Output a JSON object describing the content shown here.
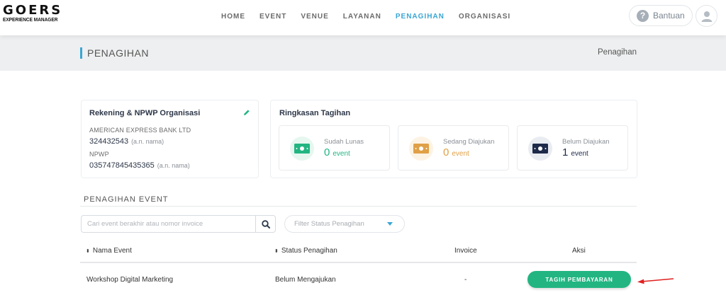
{
  "brand": {
    "name": "GOERS",
    "tagline": "EXPERIENCE MANAGER"
  },
  "nav": [
    "HOME",
    "EVENT",
    "VENUE",
    "LAYANAN",
    "PENAGIHAN",
    "ORGANISASI"
  ],
  "nav_active": "PENAGIHAN",
  "help": {
    "label": "Bantuan",
    "icon": "?"
  },
  "page": {
    "title": "PENAGIHAN",
    "breadcrumb": "Penagihan"
  },
  "rekening": {
    "title": "Rekening & NPWP Organisasi",
    "bank_name": "AMERICAN EXPRESS BANK LTD",
    "account_number": "324432543",
    "account_note": "(a.n. nama)",
    "npwp_label": "NPWP",
    "npwp_number": "035747845435365",
    "npwp_note": "(a.n. nama)"
  },
  "ringkasan": {
    "title": "Ringkasan Tagihan",
    "stats": [
      {
        "label": "Sudah Lunas",
        "value": "0",
        "unit": "event",
        "color": "#22b582",
        "bg": "#e6f7f0"
      },
      {
        "label": "Sedang Diajukan",
        "value": "0",
        "unit": "event",
        "color": "#e0a046",
        "bg": "#fdf3e4"
      },
      {
        "label": "Belum Diajukan",
        "value": "1",
        "unit": "event",
        "color": "#1e2a4a",
        "bg": "#e9ecf1"
      }
    ]
  },
  "section": {
    "title": "PENAGIHAN EVENT"
  },
  "search": {
    "placeholder": "Cari event berakhir atau nomor invoice",
    "value": ""
  },
  "filter": {
    "placeholder": "Filter Status Penagihan"
  },
  "table": {
    "columns": {
      "event": "Nama Event",
      "status": "Status Penagihan",
      "invoice": "Invoice",
      "action": "Aksi"
    },
    "sort_icon": "⬍",
    "rows": [
      {
        "event": "Workshop Digital Marketing",
        "status": "Belum Mengajukan",
        "invoice": "-",
        "action": "TAGIH PEMBAYARAN"
      }
    ]
  },
  "colors": {
    "accent": "#3aa6d4",
    "success": "#22b582",
    "arrow": "#e02020"
  }
}
